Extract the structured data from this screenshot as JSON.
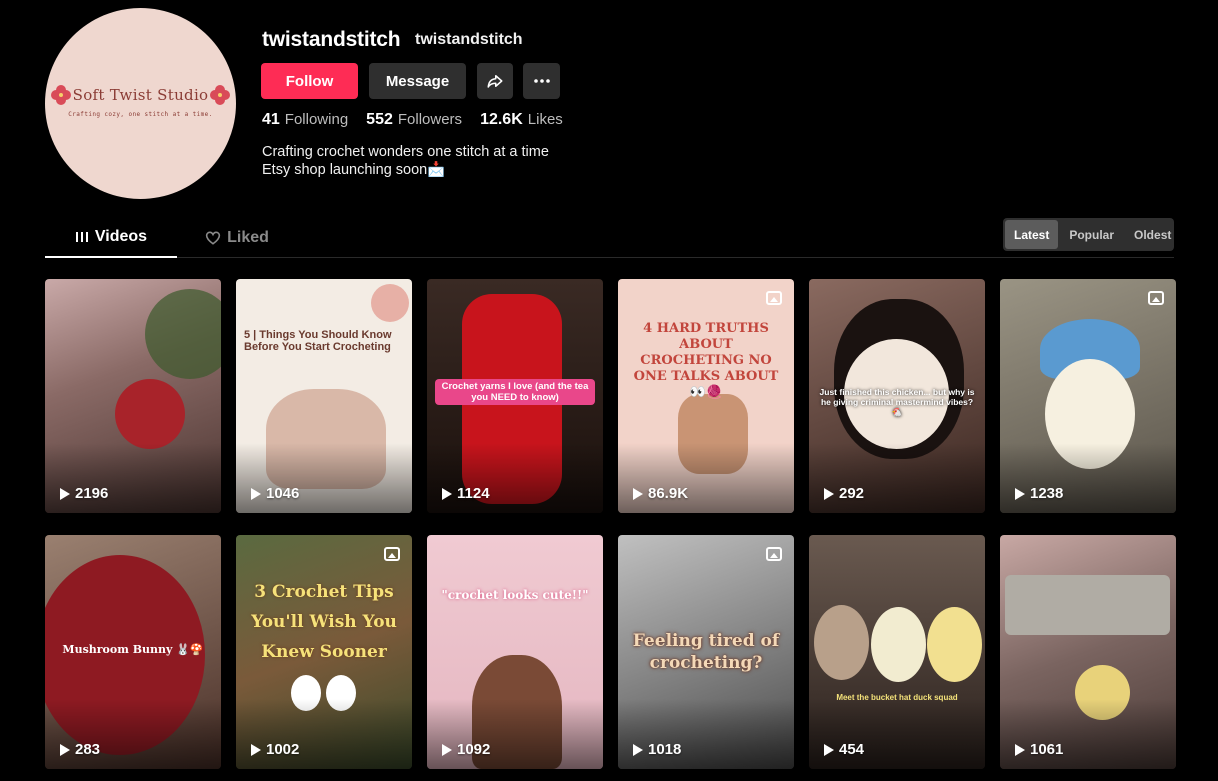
{
  "profile": {
    "avatar_logo": "Soft Twist Studio",
    "avatar_tagline": "Crafting cozy, one stitch at a time.",
    "username": "twistandstitch",
    "nickname": "twistandstitch",
    "follow_label": "Follow",
    "message_label": "Message",
    "share_icon": "share-icon",
    "more_icon": "more-icon",
    "stats": {
      "following": {
        "value": "41",
        "label": "Following"
      },
      "followers": {
        "value": "552",
        "label": "Followers"
      },
      "likes": {
        "value": "12.6K",
        "label": "Likes"
      }
    },
    "bio_line1": "Crafting crochet wonders one stitch at a time",
    "bio_line2": "Etsy shop launching soon📩"
  },
  "tabs": [
    {
      "label": "Videos",
      "icon": "grid-icon",
      "active": true
    },
    {
      "label": "Liked",
      "icon": "heart-icon",
      "active": false
    }
  ],
  "sort": [
    "Latest",
    "Popular",
    "Oldest"
  ],
  "sort_active": "Latest",
  "colors": {
    "accent": "#fe2c55",
    "button_dark": "#2f2f2f",
    "background": "#000000"
  },
  "videos": [
    {
      "views": "2196",
      "overlay": "",
      "photo": false,
      "bg": "#7a5a52"
    },
    {
      "views": "1046",
      "overlay": "5 | Things You Should Know Before You Start Crocheting",
      "photo": false,
      "bg": "#f3ece4"
    },
    {
      "views": "1124",
      "overlay": "Crochet yarns I love (and the tea you NEED to know)",
      "photo": false,
      "bg": "#2a1d18"
    },
    {
      "views": "86.9K",
      "overlay": "4 HARD TRUTHS ABOUT CROCHETING NO ONE TALKS ABOUT 👀🧶",
      "photo": true,
      "bg": "#f2d3c9"
    },
    {
      "views": "292",
      "overlay": "Just finished this chicken... but why is he giving criminal mastermind vibes? 🐔",
      "photo": false,
      "bg": "#5a3a32"
    },
    {
      "views": "1238",
      "overlay": "",
      "photo": true,
      "bg": "#7a7468"
    },
    {
      "views": "283",
      "overlay": "Mushroom Bunny 🐰🍄",
      "photo": false,
      "bg": "#8a2a2a"
    },
    {
      "views": "1002",
      "overlay": "3 Crochet Tips You'll Wish You Knew Sooner",
      "photo": true,
      "bg": "#4a5a3a"
    },
    {
      "views": "1092",
      "overlay": "\"crochet looks cute!!\"",
      "photo": false,
      "bg": "#e8c6cc"
    },
    {
      "views": "1018",
      "overlay": "Feeling tired of crocheting?",
      "photo": true,
      "bg": "#8a8a8a"
    },
    {
      "views": "454",
      "overlay": "Meet the bucket hat duck squad",
      "photo": false,
      "bg": "#3a2e2a"
    },
    {
      "views": "1061",
      "overlay": "",
      "photo": false,
      "bg": "#6a5a56"
    }
  ]
}
